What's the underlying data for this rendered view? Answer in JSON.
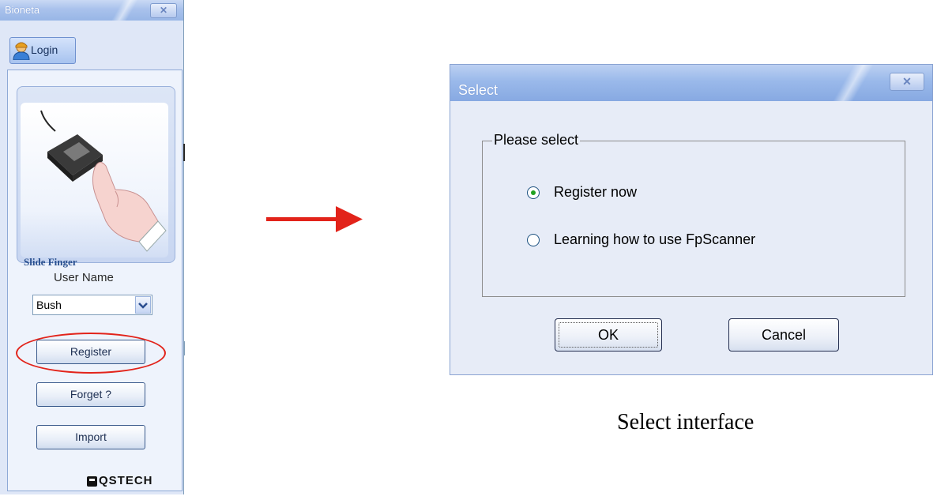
{
  "left_window": {
    "title": "Bioneta",
    "close_glyph": "✕",
    "login_tab": "Login",
    "finger_label": "Slide Finger",
    "user_name_label": "User Name",
    "user_select_value": "Bush",
    "buttons": {
      "register": "Register",
      "forget": "Forget ?",
      "import": "Import"
    },
    "brand": "QSTECH"
  },
  "dialog": {
    "title": "Select",
    "close_glyph": "✕",
    "group_legend": "Please select",
    "options": [
      {
        "label": "Register now",
        "selected": true
      },
      {
        "label": "Learning how to use FpScanner",
        "selected": false
      }
    ],
    "ok_label": "OK",
    "cancel_label": "Cancel"
  },
  "caption": "Select interface",
  "colors": {
    "accent_red": "#e2231a",
    "title_blue": "#98b6e6"
  }
}
